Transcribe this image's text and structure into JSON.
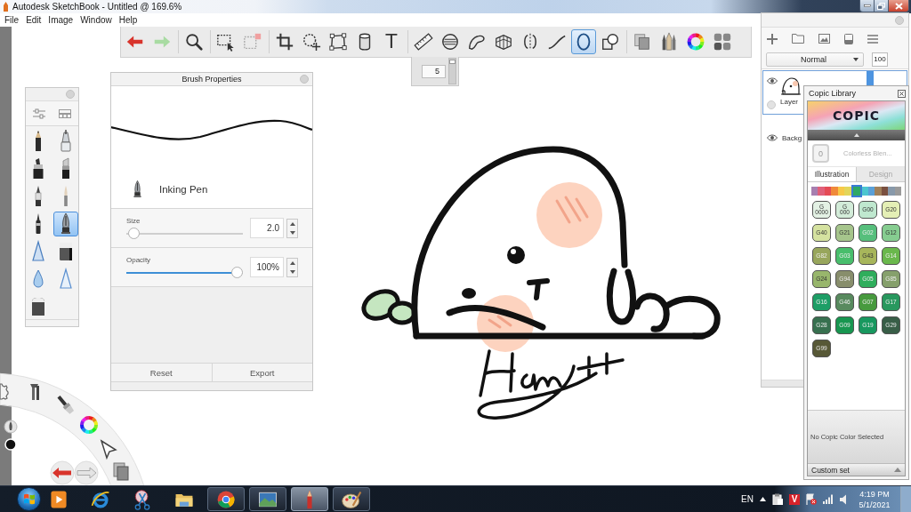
{
  "window": {
    "title": "Autodesk SketchBook - Untitled @ 169.6%"
  },
  "menu": [
    "File",
    "Edit",
    "Image",
    "Window",
    "Help"
  ],
  "toolbar": {
    "tools": [
      {
        "kind": "icon",
        "selected": false
      },
      {
        "kind": "icon",
        "selected": false
      },
      {
        "kind": "icon",
        "selected": false
      },
      {
        "kind": "icon",
        "selected": false
      },
      {
        "kind": "icon",
        "selected": false
      },
      {
        "kind": "icon",
        "selected": false
      },
      {
        "kind": "icon",
        "selected": false
      },
      {
        "kind": "icon",
        "selected": false
      },
      {
        "kind": "icon",
        "selected": false
      },
      {
        "kind": "glyph",
        "text": "T",
        "selected": false
      },
      {
        "kind": "icon",
        "selected": false
      },
      {
        "kind": "icon",
        "selected": false
      },
      {
        "kind": "icon",
        "selected": false
      },
      {
        "kind": "icon",
        "selected": false
      },
      {
        "kind": "icon",
        "selected": false
      },
      {
        "kind": "icon",
        "selected": false
      },
      {
        "kind": "icon",
        "selected": true
      },
      {
        "kind": "icon",
        "selected": false
      },
      {
        "kind": "icon",
        "selected": false
      },
      {
        "kind": "icon",
        "selected": false
      },
      {
        "kind": "icon",
        "selected": false
      },
      {
        "kind": "icon",
        "selected": false
      }
    ]
  },
  "size_popup": {
    "value": "5",
    "level": 0.95
  },
  "brush_palette": {
    "brushes": [
      {
        "selected": false
      },
      {
        "selected": false
      },
      {
        "selected": false
      },
      {
        "selected": false
      },
      {
        "selected": false
      },
      {
        "selected": false
      },
      {
        "selected": false
      },
      {
        "selected": true
      },
      {
        "selected": false
      },
      {
        "selected": false
      },
      {
        "selected": false
      },
      {
        "selected": false
      },
      {
        "selected": false
      }
    ]
  },
  "brush_properties": {
    "title": "Brush Properties",
    "brush_name": "Inking Pen",
    "size": {
      "label": "Size",
      "value": "2.0",
      "level": 0.02
    },
    "opacity": {
      "label": "Opacity",
      "value": "100%",
      "level": 1
    },
    "buttons": [
      "Reset",
      "Export"
    ]
  },
  "layers": {
    "blend_mode": "Normal",
    "opacity": "100",
    "items": [
      {
        "kind": "paint",
        "name": "Layer",
        "visible": true,
        "selected": true
      },
      {
        "kind": "background",
        "name": "Backg",
        "visible": true,
        "selected": false
      }
    ]
  },
  "copic_library": {
    "title": "Copic Library",
    "logo": "COPIC",
    "blender": {
      "code": "0",
      "name": "Colorless Blen..."
    },
    "tabs": [
      {
        "label": "Illustration",
        "selected": true
      },
      {
        "label": "Design",
        "selected": false
      }
    ],
    "families": [
      {
        "color": "#a77fb0",
        "selected": false
      },
      {
        "color": "#e0607a",
        "selected": false
      },
      {
        "color": "#e54b55",
        "selected": false
      },
      {
        "color": "#f08a3a",
        "selected": false
      },
      {
        "color": "#f7c948",
        "selected": false
      },
      {
        "color": "#e3d65a",
        "selected": false
      },
      {
        "color": "#2fa866",
        "selected": true
      },
      {
        "color": "#4cc6d0",
        "selected": false
      },
      {
        "color": "#5aa0d8",
        "selected": false
      },
      {
        "color": "#a0805a",
        "selected": false
      },
      {
        "color": "#7a5040",
        "selected": false
      },
      {
        "color": "#8899aa",
        "selected": false
      },
      {
        "color": "#9a9a9a",
        "selected": false
      }
    ],
    "swatches": [
      {
        "label": "G 0000",
        "color": "#e3f1e4"
      },
      {
        "label": "G 000",
        "color": "#d3ecd9"
      },
      {
        "label": "G00",
        "color": "#bfe8cf"
      },
      {
        "label": "G20",
        "color": "#e4efb5"
      },
      {
        "label": "G40",
        "color": "#d5e2a0"
      },
      {
        "label": "G21",
        "color": "#a6c58c"
      },
      {
        "label": "G02",
        "color": "#56bf7c"
      },
      {
        "label": "G12",
        "color": "#86cd90"
      },
      {
        "label": "G82",
        "color": "#98a65c"
      },
      {
        "label": "G03",
        "color": "#48be6c"
      },
      {
        "label": "G43",
        "color": "#a7b65b"
      },
      {
        "label": "G14",
        "color": "#6ab84c"
      },
      {
        "label": "G24",
        "color": "#98b66c"
      },
      {
        "label": "G94",
        "color": "#888e6c"
      },
      {
        "label": "G05",
        "color": "#2fae5c"
      },
      {
        "label": "G85",
        "color": "#86a06c"
      },
      {
        "label": "G16",
        "color": "#1d9e66"
      },
      {
        "label": "G46",
        "color": "#588a5e"
      },
      {
        "label": "G07",
        "color": "#479a3e"
      },
      {
        "label": "G17",
        "color": "#28985e"
      },
      {
        "label": "G28",
        "color": "#37704f"
      },
      {
        "label": "G09",
        "color": "#189650"
      },
      {
        "label": "G19",
        "color": "#18985f"
      },
      {
        "label": "G29",
        "color": "#385e47"
      },
      {
        "label": "G99",
        "color": "#575836"
      }
    ],
    "status": "No Copic Color Selected",
    "custom_set": "Custom set"
  },
  "taskbar": {
    "apps": [
      {
        "open": false,
        "selected": false
      },
      {
        "open": false,
        "selected": false
      },
      {
        "open": false,
        "selected": false
      },
      {
        "open": false,
        "selected": false
      },
      {
        "open": true,
        "selected": false
      },
      {
        "open": true,
        "selected": false
      },
      {
        "open": true,
        "selected": true
      },
      {
        "open": true,
        "selected": false
      }
    ],
    "language": "EN",
    "tray_badge": "V",
    "time": "4:19 PM",
    "date": "5/1/2021"
  }
}
